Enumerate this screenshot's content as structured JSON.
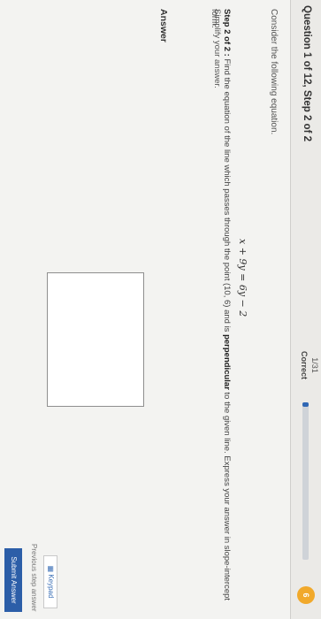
{
  "header": {
    "question_title": "Question 1 of 12, Step 2 of 2",
    "score": "1/31",
    "status": "Correct",
    "progress_fraction": 0.03,
    "badge": "6",
    "accent_color": "#2f67b4",
    "badge_color": "#f1a92b"
  },
  "problem": {
    "intro": "Consider the following equation.",
    "equation": "x + 9y = 6y − 2",
    "step_label": "Step 2 of 2 :",
    "instruction_1": " Find the equation of the line which passes through the point (10, 6) and is ",
    "instruction_bold": "perpendicular",
    "instruction_2": " to the given line. Express your answer in slope-intercept form.",
    "simplify": "Simplify your answer."
  },
  "answer": {
    "label": "Answer",
    "value": ""
  },
  "footer": {
    "keypad_label": "Keypad",
    "previous_label": "Previous step answer",
    "submit_label": "Submit Answer"
  }
}
